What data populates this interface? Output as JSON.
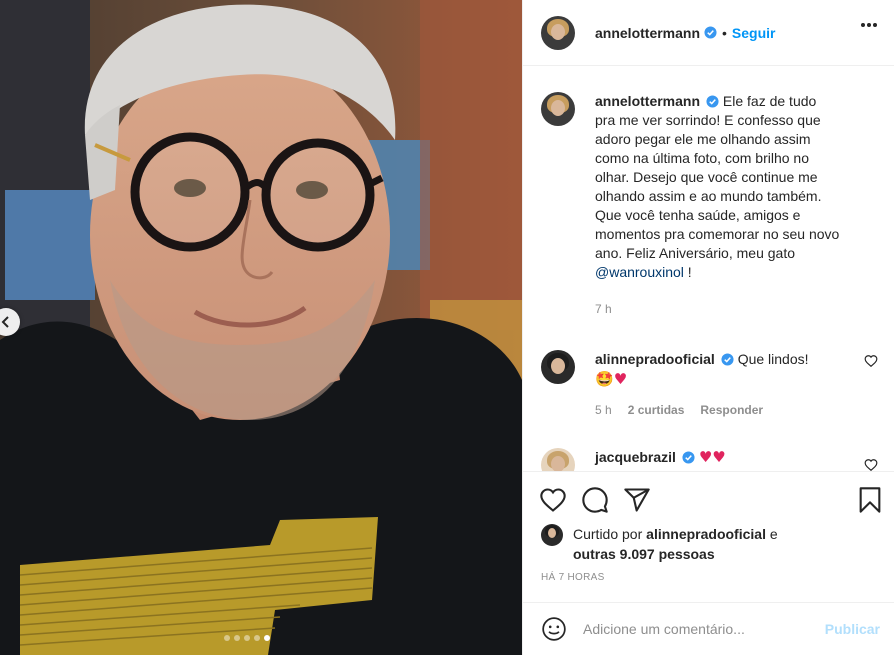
{
  "post": {
    "carousel": {
      "slide_count": 5,
      "active_slide": 5
    }
  },
  "header": {
    "username": "annelottermann",
    "separator": "•",
    "follow_label": "Seguir"
  },
  "caption": {
    "username": "annelottermann",
    "text": "Ele faz de tudo pra me ver sorrindo! E confesso que adoro pegar ele me olhando assim como na última foto, com brilho no olhar. Desejo que você continue me olhando assim e ao mundo também. Que você tenha saúde, amigos e momentos pra comemorar no seu novo ano. Feliz Aniversário, meu gato ",
    "mention": "@wanrouxinol",
    "suffix": " !",
    "time": "7 h"
  },
  "comments": [
    {
      "username": "alinnepradooficial",
      "text": "Que lindos!",
      "emojis": "🤩",
      "heart": "♥",
      "time": "5 h",
      "likes": "2 curtidas",
      "reply_label": "Responder"
    },
    {
      "username": "jacquebrazil",
      "hearts": "♥♥"
    }
  ],
  "likes": {
    "prefix": "Curtido por ",
    "user": "alinnepradooficial",
    "middle": " e",
    "others": "outras 9.097 pessoas"
  },
  "timestamp": "HÁ 7 HORAS",
  "add_comment": {
    "placeholder": "Adicione um comentário...",
    "publish_label": "Publicar"
  },
  "icons": {
    "like": "heart-outline-icon",
    "comment": "comment-bubble-icon",
    "share": "paper-plane-icon",
    "save": "bookmark-icon",
    "emoji": "smiley-icon",
    "more": "more-horizontal-icon",
    "verified": "verified-badge-icon"
  },
  "colors": {
    "accent": "#0095f6",
    "verified": "#3897f0",
    "publish_disabled": "#b2dffc",
    "heart": "#e0245e"
  }
}
